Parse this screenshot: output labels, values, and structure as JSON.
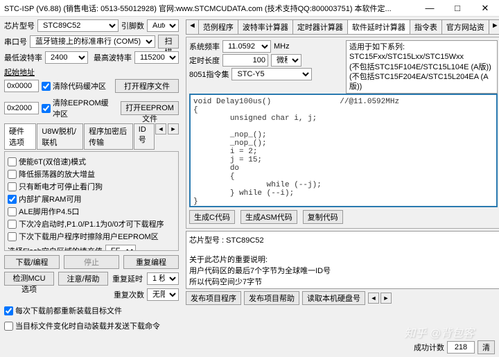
{
  "title": "STC-ISP (V6.88) (销售电话: 0513-55012928) 官网:www.STCMCUDATA.com (技术支持QQ:800003751) 本软件定...",
  "left": {
    "chipLabel": "芯片型号",
    "chipValue": "STC89C52",
    "pinLabel": "引脚数",
    "pinValue": "Auto",
    "portLabel": "串口号",
    "portValue": "蓝牙链接上的标准串行 (COM5)",
    "scanBtn": "扫描",
    "minBaudLabel": "最低波特率",
    "minBaud": "2400",
    "maxBaudLabel": "最高波特率",
    "maxBaud": "115200",
    "startAddrLabel": "起始地址",
    "addr1": "0x0000",
    "chk1": "清除代码缓冲区",
    "openCodeBtn": "打开程序文件",
    "addr2": "0x2000",
    "chk2": "清除EEPROM缓冲区",
    "openEepromBtn": "打开EEPROM文件",
    "hwTabs": [
      "硬件选项",
      "U8W脱机/联机",
      "程序加密后传输",
      "ID号"
    ],
    "opt1": "使能6T(双倍速)模式",
    "opt2": "降低振荡器的放大增益",
    "opt3": "只有断电才可停止看门狗",
    "opt4": "内部扩展RAM可用",
    "opt5": "ALE脚用作P4.5口",
    "opt6": "下次冷启动时,P1.0/P1.1为0/0才可下载程序",
    "opt7": "下次下载用户程序时擦除用户EEPROM区",
    "flashLabel": "选择Flash空白区域的填充值",
    "flashVal": "FF",
    "dlBtn": "下载/编程",
    "stopBtn": "停止",
    "reprogBtn": "重复编程",
    "detectBtn": "检测MCU选项",
    "helpBtn": "注意/帮助",
    "repDelayLabel": "重复延时",
    "repDelay": "1 秒",
    "repCountLabel": "重复次数",
    "repCount": "无限",
    "bottomChk1": "每次下载前都重新装载目标文件",
    "bottomChk2": "当目标文件变化时自动装载并发送下载命令"
  },
  "right": {
    "tabs": [
      "范例程序",
      "波特率计算器",
      "定时器计算器",
      "软件延时计算器",
      "指令表",
      "官方网站资"
    ],
    "sysFreqLabel": "系统频率",
    "sysFreq": "11.0592",
    "sysFreqUnit": "MHz",
    "delayLabel": "定时长度",
    "delayVal": "100",
    "delayUnit": "微秒",
    "instrSetLabel": "8051指令集",
    "instrSet": "STC-Y5",
    "noteHeader": "适用于如下系列:",
    "note1": "STC15Fxx/STC15Lxx/STC15Wxx",
    "note2": "(不包括STC15F104E/STC15L104E (A版))",
    "note3": "(不包括STC15F204EA/STC15L204EA (A版))",
    "code": "void Delay100us()\t\t//@11.0592MHz\n{\n\tunsigned char i, j;\n\n\t_nop_();\n\t_nop_();\n\ti = 2;\n\tj = 15;\n\tdo\n\t{\n\t\twhile (--j);\n\t} while (--i);\n}",
    "genCBtn": "生成C代码",
    "genAsmBtn": "生成ASM代码",
    "copyBtn": "复制代码",
    "infoLn1": "芯片型号 : STC89C52",
    "infoLn2": "关于此芯片的重要说明:",
    "infoLn3": "  用户代码区的最后7个字节为全球唯一ID号",
    "infoLn4": "  所以代码空间少7字节",
    "pubTabs": [
      "发布项目程序",
      "发布项目帮助",
      "读取本机硬盘号"
    ],
    "succLabel": "成功计数",
    "succVal": "218",
    "clearBtn": "清"
  },
  "watermark": "知乎 @背包客"
}
